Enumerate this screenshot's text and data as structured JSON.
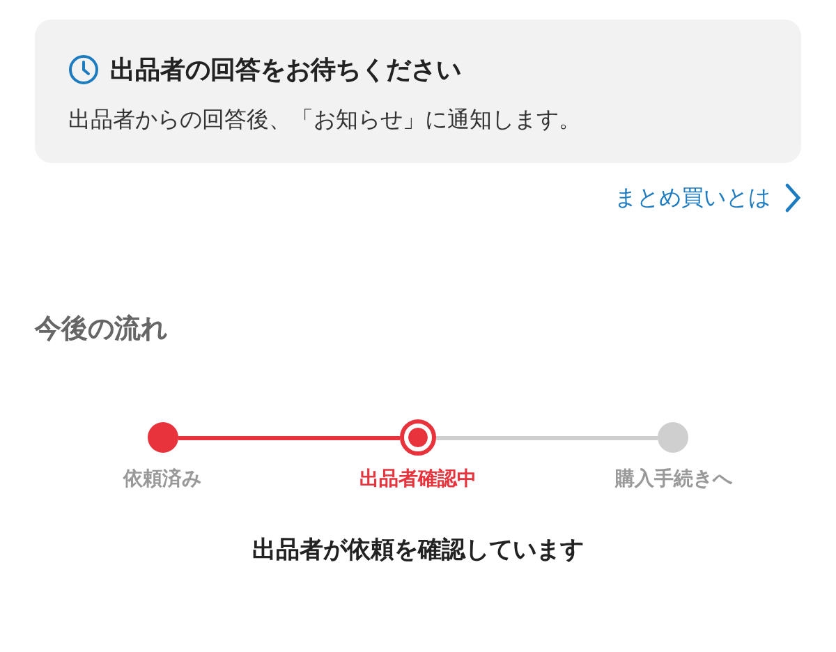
{
  "notice": {
    "title": "出品者の回答をお待ちください",
    "body": "出品者からの回答後、「お知らせ」に通知します。"
  },
  "link": {
    "label": "まとめ買いとは"
  },
  "flow": {
    "heading": "今後の流れ",
    "steps": [
      {
        "label": "依頼済み",
        "completed": true,
        "selected": false
      },
      {
        "label": "出品者確認中",
        "completed": false,
        "selected": true
      },
      {
        "label": "購入手続きへ",
        "completed": false,
        "selected": false
      }
    ],
    "message": "出品者が依頼を確認しています"
  }
}
